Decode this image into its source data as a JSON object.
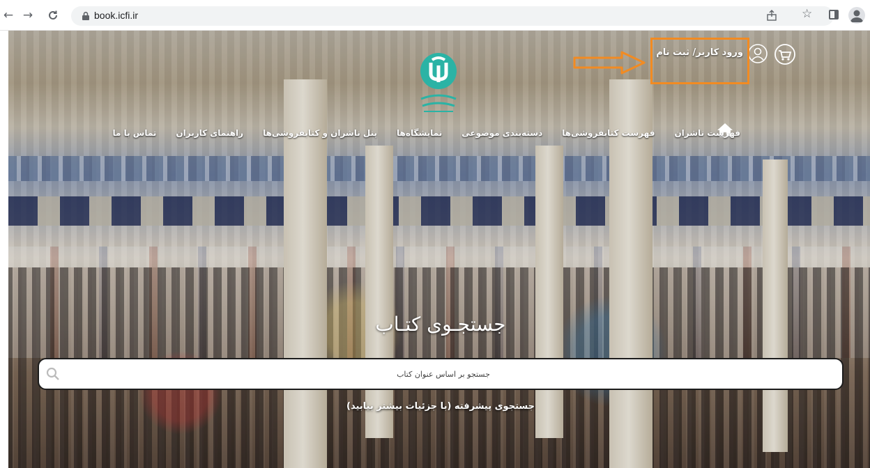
{
  "browser": {
    "url": "book.icfi.ir",
    "back_icon": "back-arrow-icon",
    "forward_icon": "forward-arrow-icon",
    "reload_icon": "reload-icon"
  },
  "header": {
    "login_label": "ورود کاربر/ ثبت نام",
    "logo_icon": "icfi-logo-icon",
    "cart_icon": "cart-icon",
    "user_icon": "user-icon"
  },
  "nav": {
    "home_icon": "home-icon",
    "items": [
      {
        "label": "فهرست ناشران"
      },
      {
        "label": "فهرست کتابفروشی‌ها"
      },
      {
        "label": "دسته‌بندی موضوعی"
      },
      {
        "label": "نمایشگاه‌ها"
      },
      {
        "label": "پنل ناشران و کتابفروشی‌ها"
      },
      {
        "label": "راهنمای کاربران"
      },
      {
        "label": "تماس با ما"
      }
    ]
  },
  "search": {
    "title": "جستجـوی کتـاب",
    "placeholder": "جستجو بر اساس عنوان کتاب",
    "advanced_label": "جستجوی پیشرفته (با جزئیات بیشتر بیابید)"
  },
  "annotation": {
    "color": "#f28b22"
  }
}
